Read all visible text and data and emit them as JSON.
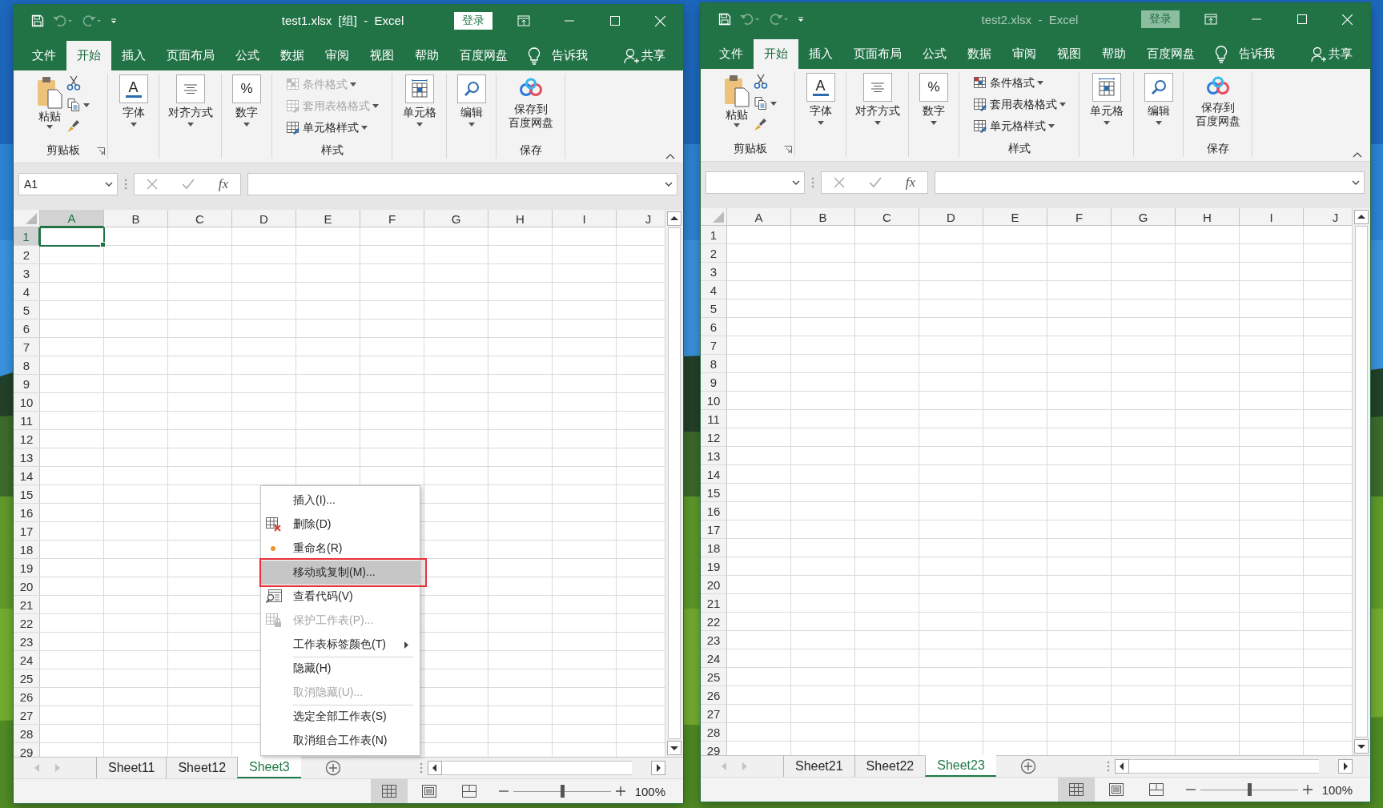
{
  "windows": [
    {
      "title": "test1.xlsx  [组]  -  Excel",
      "active": true,
      "sign_in": "登录",
      "tabs": [
        {
          "label": "文件",
          "selected": false
        },
        {
          "label": "开始",
          "selected": true
        },
        {
          "label": "插入",
          "selected": false
        },
        {
          "label": "页面布局",
          "selected": false
        },
        {
          "label": "公式",
          "selected": false
        },
        {
          "label": "数据",
          "selected": false
        },
        {
          "label": "审阅",
          "selected": false
        },
        {
          "label": "视图",
          "selected": false
        },
        {
          "label": "帮助",
          "selected": false
        },
        {
          "label": "百度网盘",
          "selected": false
        }
      ],
      "tell_me": "告诉我",
      "share": "共享",
      "ribbon": [
        {
          "kind": "clipboard",
          "label": "剪贴板",
          "paste": "粘贴"
        },
        {
          "kind": "font",
          "button": "字体",
          "icon_text": "A"
        },
        {
          "kind": "alignment",
          "button": "对齐方式"
        },
        {
          "kind": "number",
          "button": "数字",
          "icon_text": "%"
        },
        {
          "kind": "styles",
          "label": "样式",
          "items": [
            {
              "label": "条件格式",
              "disabled": true
            },
            {
              "label": "套用表格格式",
              "disabled": true
            },
            {
              "label": "单元格样式",
              "disabled": false
            }
          ]
        },
        {
          "kind": "cells",
          "button": "单元格"
        },
        {
          "kind": "editing",
          "button": "编辑"
        },
        {
          "kind": "save",
          "label": "保存",
          "button_lines": [
            "保存到",
            "百度网盘"
          ]
        }
      ],
      "name_box": "A1",
      "function_label": "fx",
      "columns": [
        {
          "label": "A",
          "selected": true
        },
        {
          "label": "B",
          "selected": false
        },
        {
          "label": "C",
          "selected": false
        },
        {
          "label": "D",
          "selected": false
        },
        {
          "label": "E",
          "selected": false
        },
        {
          "label": "F",
          "selected": false
        },
        {
          "label": "G",
          "selected": false
        },
        {
          "label": "H",
          "selected": false
        },
        {
          "label": "I",
          "selected": false
        },
        {
          "label": "J",
          "selected": false
        }
      ],
      "rows": [
        {
          "label": "1",
          "selected": true
        },
        {
          "label": "2",
          "selected": false
        },
        {
          "label": "3",
          "selected": false
        },
        {
          "label": "4",
          "selected": false
        },
        {
          "label": "5",
          "selected": false
        },
        {
          "label": "6",
          "selected": false
        },
        {
          "label": "7",
          "selected": false
        },
        {
          "label": "8",
          "selected": false
        },
        {
          "label": "9",
          "selected": false
        },
        {
          "label": "10",
          "selected": false
        },
        {
          "label": "11",
          "selected": false
        },
        {
          "label": "12",
          "selected": false
        },
        {
          "label": "13",
          "selected": false
        },
        {
          "label": "14",
          "selected": false
        },
        {
          "label": "15",
          "selected": false
        },
        {
          "label": "16",
          "selected": false
        },
        {
          "label": "17",
          "selected": false
        },
        {
          "label": "18",
          "selected": false
        },
        {
          "label": "19",
          "selected": false
        },
        {
          "label": "20",
          "selected": false
        },
        {
          "label": "21",
          "selected": false
        },
        {
          "label": "22",
          "selected": false
        },
        {
          "label": "23",
          "selected": false
        },
        {
          "label": "24",
          "selected": false
        },
        {
          "label": "25",
          "selected": false
        },
        {
          "label": "26",
          "selected": false
        },
        {
          "label": "27",
          "selected": false
        },
        {
          "label": "28",
          "selected": false
        },
        {
          "label": "29",
          "selected": false
        }
      ],
      "sheets": [
        {
          "label": "Sheet11",
          "selected": false
        },
        {
          "label": "Sheet12",
          "selected": false
        },
        {
          "label": "Sheet3",
          "selected": true
        }
      ],
      "zoom": "100%",
      "zoom_slider": {
        "level": 0.5
      },
      "context_menu": {
        "items": [
          {
            "label": "插入(I)...",
            "kind": "plain",
            "disabled": false,
            "highlighted": false,
            "outlined": false,
            "submenu": false,
            "separator_before": false
          },
          {
            "label": "删除(D)",
            "kind": "delete",
            "disabled": false,
            "highlighted": false,
            "outlined": false,
            "submenu": false,
            "separator_before": false
          },
          {
            "label": "重命名(R)",
            "kind": "rename",
            "disabled": false,
            "highlighted": false,
            "outlined": false,
            "submenu": false,
            "separator_before": false
          },
          {
            "label": "移动或复制(M)...",
            "kind": "plain",
            "disabled": false,
            "highlighted": true,
            "outlined": true,
            "submenu": false,
            "separator_before": false
          },
          {
            "label": "查看代码(V)",
            "kind": "view-code",
            "disabled": false,
            "highlighted": false,
            "outlined": false,
            "submenu": false,
            "separator_before": false
          },
          {
            "label": "保护工作表(P)...",
            "kind": "protect",
            "disabled": true,
            "highlighted": false,
            "outlined": false,
            "submenu": false,
            "separator_before": false
          },
          {
            "label": "工作表标签颜色(T)",
            "kind": "plain",
            "disabled": false,
            "highlighted": false,
            "outlined": false,
            "submenu": true,
            "separator_before": false
          },
          {
            "label": "隐藏(H)",
            "kind": "plain",
            "disabled": false,
            "highlighted": false,
            "outlined": false,
            "submenu": false,
            "separator_before": true
          },
          {
            "label": "取消隐藏(U)...",
            "kind": "plain",
            "disabled": true,
            "highlighted": false,
            "outlined": false,
            "submenu": false,
            "separator_before": false
          },
          {
            "label": "选定全部工作表(S)",
            "kind": "plain",
            "disabled": false,
            "highlighted": false,
            "outlined": false,
            "submenu": false,
            "separator_before": true
          },
          {
            "label": "取消组合工作表(N)",
            "kind": "plain",
            "disabled": false,
            "highlighted": false,
            "outlined": false,
            "submenu": false,
            "separator_before": false
          }
        ]
      }
    },
    {
      "title": "test2.xlsx  -  Excel",
      "active": false,
      "sign_in": "登录",
      "tabs": [
        {
          "label": "文件",
          "selected": false
        },
        {
          "label": "开始",
          "selected": true
        },
        {
          "label": "插入",
          "selected": false
        },
        {
          "label": "页面布局",
          "selected": false
        },
        {
          "label": "公式",
          "selected": false
        },
        {
          "label": "数据",
          "selected": false
        },
        {
          "label": "审阅",
          "selected": false
        },
        {
          "label": "视图",
          "selected": false
        },
        {
          "label": "帮助",
          "selected": false
        },
        {
          "label": "百度网盘",
          "selected": false
        }
      ],
      "tell_me": "告诉我",
      "share": "共享",
      "ribbon": [
        {
          "kind": "clipboard",
          "label": "剪贴板",
          "paste": "粘贴"
        },
        {
          "kind": "font",
          "button": "字体",
          "icon_text": "A"
        },
        {
          "kind": "alignment",
          "button": "对齐方式"
        },
        {
          "kind": "number",
          "button": "数字",
          "icon_text": "%"
        },
        {
          "kind": "styles",
          "label": "样式",
          "items": [
            {
              "label": "条件格式",
              "disabled": false
            },
            {
              "label": "套用表格格式",
              "disabled": false
            },
            {
              "label": "单元格样式",
              "disabled": false
            }
          ]
        },
        {
          "kind": "cells",
          "button": "单元格"
        },
        {
          "kind": "editing",
          "button": "编辑"
        },
        {
          "kind": "save",
          "label": "保存",
          "button_lines": [
            "保存到",
            "百度网盘"
          ]
        }
      ],
      "function_label": "fx",
      "columns": [
        {
          "label": "A",
          "selected": false
        },
        {
          "label": "B",
          "selected": false
        },
        {
          "label": "C",
          "selected": false
        },
        {
          "label": "D",
          "selected": false
        },
        {
          "label": "E",
          "selected": false
        },
        {
          "label": "F",
          "selected": false
        },
        {
          "label": "G",
          "selected": false
        },
        {
          "label": "H",
          "selected": false
        },
        {
          "label": "I",
          "selected": false
        },
        {
          "label": "J",
          "selected": false
        }
      ],
      "rows": [
        {
          "label": "1",
          "selected": false
        },
        {
          "label": "2",
          "selected": false
        },
        {
          "label": "3",
          "selected": false
        },
        {
          "label": "4",
          "selected": false
        },
        {
          "label": "5",
          "selected": false
        },
        {
          "label": "6",
          "selected": false
        },
        {
          "label": "7",
          "selected": false
        },
        {
          "label": "8",
          "selected": false
        },
        {
          "label": "9",
          "selected": false
        },
        {
          "label": "10",
          "selected": false
        },
        {
          "label": "11",
          "selected": false
        },
        {
          "label": "12",
          "selected": false
        },
        {
          "label": "13",
          "selected": false
        },
        {
          "label": "14",
          "selected": false
        },
        {
          "label": "15",
          "selected": false
        },
        {
          "label": "16",
          "selected": false
        },
        {
          "label": "17",
          "selected": false
        },
        {
          "label": "18",
          "selected": false
        },
        {
          "label": "19",
          "selected": false
        },
        {
          "label": "20",
          "selected": false
        },
        {
          "label": "21",
          "selected": false
        },
        {
          "label": "22",
          "selected": false
        },
        {
          "label": "23",
          "selected": false
        },
        {
          "label": "24",
          "selected": false
        },
        {
          "label": "25",
          "selected": false
        },
        {
          "label": "26",
          "selected": false
        },
        {
          "label": "27",
          "selected": false
        },
        {
          "label": "28",
          "selected": false
        },
        {
          "label": "29",
          "selected": false
        }
      ],
      "sheets": [
        {
          "label": "Sheet21",
          "selected": false
        },
        {
          "label": "Sheet22",
          "selected": false
        },
        {
          "label": "Sheet23",
          "selected": true
        }
      ],
      "zoom": "100%",
      "zoom_slider": {
        "level": 0.5
      }
    }
  ]
}
